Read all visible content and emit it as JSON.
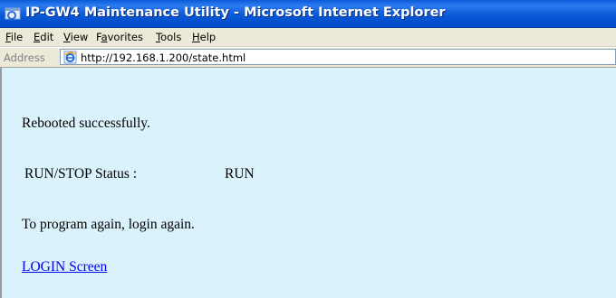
{
  "window": {
    "title": "IP-GW4 Maintenance Utility - Microsoft Internet Explorer",
    "title_bar_color": "#0a5ad8"
  },
  "menu": {
    "items": [
      {
        "key": "F",
        "rest": "ile"
      },
      {
        "key": "E",
        "rest": "dit"
      },
      {
        "key": "V",
        "rest": "iew"
      },
      {
        "key": "a",
        "pre": "F",
        "rest": "vorites"
      },
      {
        "key": "T",
        "rest": "ools"
      },
      {
        "key": "H",
        "rest": "elp"
      }
    ]
  },
  "address_bar": {
    "label": "Address",
    "url": "http://192.168.1.200/state.html",
    "icon": "ie-page-icon"
  },
  "page": {
    "background": "#d9f2fb",
    "reboot_message": "Rebooted successfully.",
    "status_label": "RUN/STOP Status :",
    "status_value": "RUN",
    "instruction": "To program again, login again.",
    "login_link": "LOGIN Screen"
  }
}
